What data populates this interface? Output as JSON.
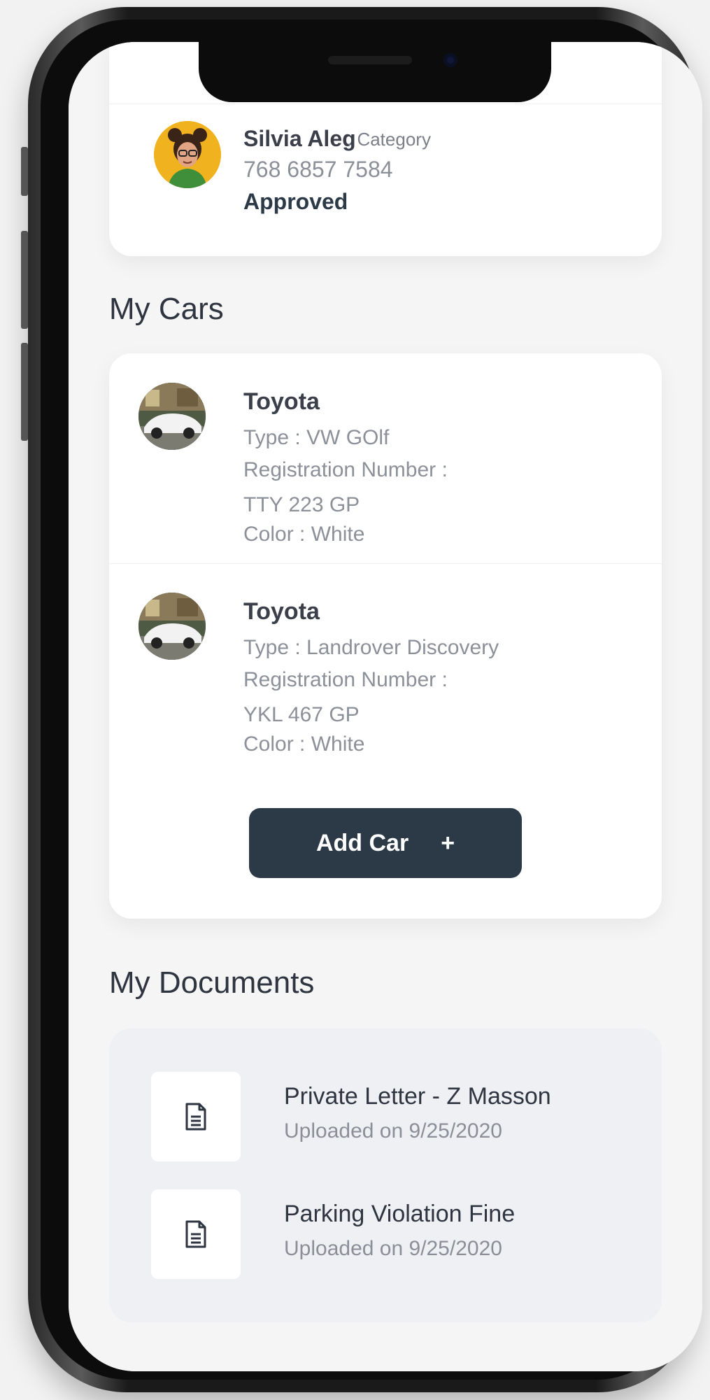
{
  "profile": {
    "name": "Silvia Aleg",
    "category": ". Category",
    "phone": "768 6857 7584",
    "status": "Approved"
  },
  "cars_section": {
    "title": "My Cars",
    "cars": [
      {
        "title": "Toyota",
        "type": "Type : VW GOlf",
        "reg_label": "Registration Number  :",
        "reg_value": "TTY 223 GP",
        "color": "Color : White"
      },
      {
        "title": "Toyota",
        "type": "Type : Landrover Discovery",
        "reg_label": "Registration Number :",
        "reg_value": "YKL 467 GP",
        "color": "Color : White"
      }
    ],
    "add_button_label": "Add Car",
    "add_button_symbol": "+"
  },
  "documents_section": {
    "title": "My Documents",
    "documents": [
      {
        "title": "Private Letter - Z Masson",
        "subtitle": "Uploaded on 9/25/2020",
        "icon": "document-icon"
      },
      {
        "title": "Parking Violation Fine",
        "subtitle": "Uploaded on 9/25/2020",
        "icon": "document-icon"
      }
    ]
  },
  "colors": {
    "accent": "#2c3a48",
    "background": "#f5f5f5",
    "card": "#ffffff",
    "docs_card": "#eef0f3"
  }
}
